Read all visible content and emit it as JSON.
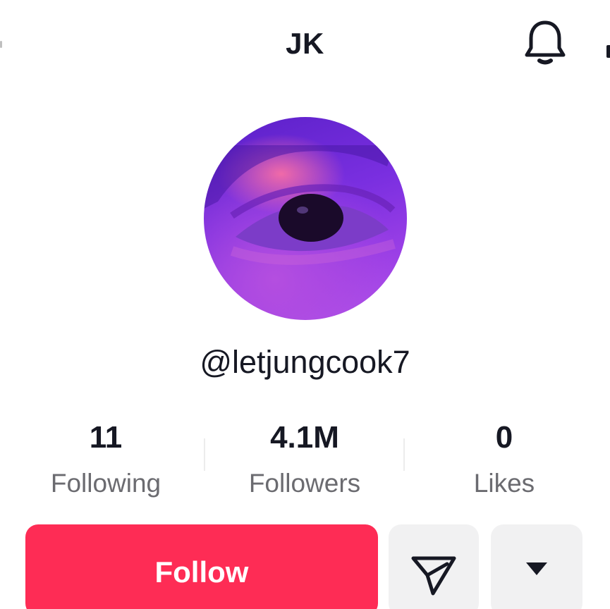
{
  "header": {
    "title": "JK",
    "bell_icon": "bell-icon"
  },
  "profile": {
    "handle": "@letjungcook7",
    "avatar_colors": [
      "#5a20c8",
      "#9b3fe6",
      "#f06aa8"
    ]
  },
  "stats": [
    {
      "value": "11",
      "label": "Following"
    },
    {
      "value": "4.1M",
      "label": "Followers"
    },
    {
      "value": "0",
      "label": "Likes"
    }
  ],
  "actions": {
    "follow_label": "Follow",
    "share_icon": "send-icon",
    "more_icon": "caret-down-icon"
  },
  "colors": {
    "accent": "#fe2c55",
    "secondary_button": "#f1f1f2",
    "text": "#161823",
    "muted_text": "#6b6b70"
  }
}
